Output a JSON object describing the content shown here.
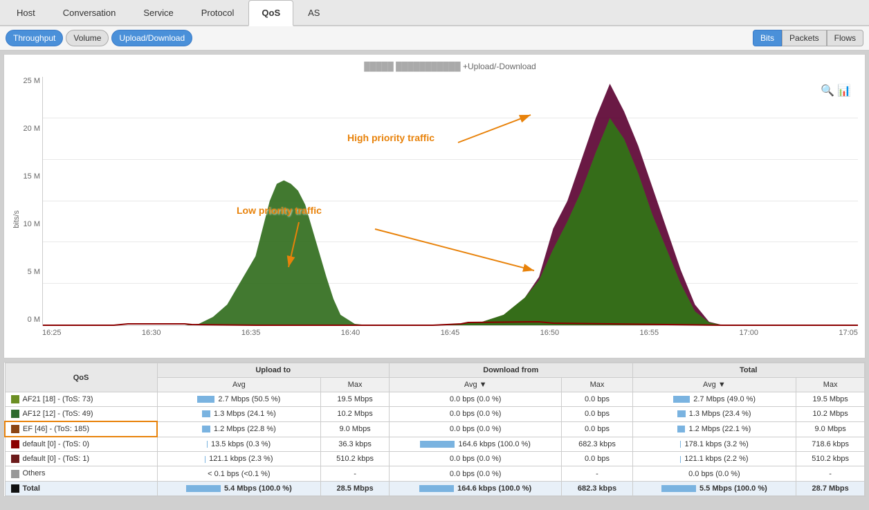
{
  "tabs": [
    {
      "label": "Host",
      "active": false
    },
    {
      "label": "Conversation",
      "active": false
    },
    {
      "label": "Service",
      "active": false
    },
    {
      "label": "Protocol",
      "active": false
    },
    {
      "label": "QoS",
      "active": true
    },
    {
      "label": "AS",
      "active": false
    }
  ],
  "sub_tabs": [
    {
      "label": "Throughput",
      "active": true
    },
    {
      "label": "Volume",
      "active": false
    },
    {
      "label": "Upload/Download",
      "active": true
    }
  ],
  "view_buttons": [
    {
      "label": "Bits",
      "active": true
    },
    {
      "label": "Packets",
      "active": false
    },
    {
      "label": "Flows",
      "active": false
    }
  ],
  "chart": {
    "title": "+Upload/-Download",
    "y_labels": [
      "0 M",
      "5 M",
      "10 M",
      "15 M",
      "20 M",
      "25 M"
    ],
    "x_labels": [
      "16:25",
      "16:30",
      "16:35",
      "16:40",
      "16:45",
      "16:50",
      "16:55",
      "17:00",
      "17:05"
    ],
    "y_axis_label": "bits/s",
    "annotation_high": "High priority traffic",
    "annotation_low": "Low priority traffic"
  },
  "table": {
    "section_headers": [
      {
        "label": "QoS",
        "colspan": 1
      },
      {
        "label": "Upload to",
        "colspan": 2
      },
      {
        "label": "Download from",
        "colspan": 2
      },
      {
        "label": "Total",
        "colspan": 2
      }
    ],
    "col_headers": [
      "QoS",
      "Avg",
      "Max",
      "Avg ▼",
      "Max",
      "Avg ▼",
      "Max"
    ],
    "rows": [
      {
        "color": "#6b8e23",
        "label": "AF21 [18] - (ToS: 73)",
        "upload_avg": "2.7 Mbps (50.5 %)",
        "upload_avg_bar": 50,
        "upload_max": "19.5 Mbps",
        "download_avg": "0.0 bps (0.0 %)",
        "download_avg_bar": 0,
        "download_max": "0.0 bps",
        "total_avg": "2.7 Mbps (49.0 %)",
        "total_avg_bar": 49,
        "total_max": "19.5 Mbps",
        "highlighted": false
      },
      {
        "color": "#2d6a2d",
        "label": "AF12 [12] - (ToS: 49)",
        "upload_avg": "1.3 Mbps (24.1 %)",
        "upload_avg_bar": 24,
        "upload_max": "10.2 Mbps",
        "download_avg": "0.0 bps (0.0 %)",
        "download_avg_bar": 0,
        "download_max": "0.0 bps",
        "total_avg": "1.3 Mbps (23.4 %)",
        "total_avg_bar": 23,
        "total_max": "10.2 Mbps",
        "highlighted": false
      },
      {
        "color": "#8b4513",
        "label": "EF [46] - (ToS: 185)",
        "upload_avg": "1.2 Mbps (22.8 %)",
        "upload_avg_bar": 23,
        "upload_max": "9.0 Mbps",
        "download_avg": "0.0 bps (0.0 %)",
        "download_avg_bar": 0,
        "download_max": "0.0 bps",
        "total_avg": "1.2 Mbps (22.1 %)",
        "total_avg_bar": 22,
        "total_max": "9.0 Mbps",
        "highlighted": true
      },
      {
        "color": "#8b0000",
        "label": "default [0] - (ToS: 0)",
        "upload_avg": "13.5 kbps (0.3 %)",
        "upload_avg_bar": 1,
        "upload_max": "36.3 kbps",
        "download_avg": "164.6 kbps (100.0 %)",
        "download_avg_bar": 100,
        "download_max": "682.3 kbps",
        "total_avg": "178.1 kbps (3.2 %)",
        "total_avg_bar": 3,
        "total_max": "718.6 kbps",
        "highlighted": false
      },
      {
        "color": "#6b1a1a",
        "label": "default [0] - (ToS: 1)",
        "upload_avg": "121.1 kbps (2.3 %)",
        "upload_avg_bar": 2,
        "upload_max": "510.2 kbps",
        "download_avg": "0.0 bps (0.0 %)",
        "download_avg_bar": 0,
        "download_max": "0.0 bps",
        "total_avg": "121.1 kbps (2.2 %)",
        "total_avg_bar": 2,
        "total_max": "510.2 kbps",
        "highlighted": false
      },
      {
        "color": "#999999",
        "label": "Others",
        "upload_avg": "< 0.1 bps (<0.1 %)",
        "upload_avg_bar": 0,
        "upload_max": "-",
        "download_avg": "0.0 bps (0.0 %)",
        "download_avg_bar": 0,
        "download_max": "-",
        "total_avg": "0.0 bps (0.0 %)",
        "total_avg_bar": 0,
        "total_max": "-",
        "highlighted": false
      },
      {
        "color": "#111111",
        "label": "Total",
        "upload_avg": "5.4 Mbps (100.0 %)",
        "upload_avg_bar": 100,
        "upload_max": "28.5 Mbps",
        "download_avg": "164.6 kbps (100.0 %)",
        "download_avg_bar": 100,
        "download_max": "682.3 kbps",
        "total_avg": "5.5 Mbps (100.0 %)",
        "total_avg_bar": 100,
        "total_max": "28.7 Mbps",
        "highlighted": false,
        "is_total": true
      }
    ]
  }
}
